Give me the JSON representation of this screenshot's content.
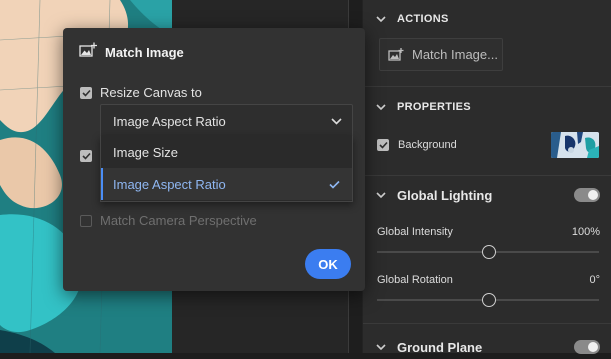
{
  "dialog": {
    "title": "Match Image",
    "resize_label": "Resize Canvas to",
    "dropdown_value": "Image Aspect Ratio",
    "options": [
      "Image Size",
      "Image Aspect Ratio"
    ],
    "selected_option": "Image Aspect Ratio",
    "match_camera_label": "Match Camera Perspective",
    "ok_label": "OK"
  },
  "panel": {
    "actions_title": "ACTIONS",
    "action_item": "Match Image...",
    "properties_title": "PROPERTIES",
    "background_label": "Background",
    "global_lighting_title": "Global Lighting",
    "global_intensity_label": "Global Intensity",
    "global_intensity_value": "100%",
    "global_rotation_label": "Global Rotation",
    "global_rotation_value": "0°",
    "ground_plane_title": "Ground Plane"
  },
  "colors": {
    "accent": "#3b7df0",
    "selected_text": "#8fb7f2",
    "panel_bg": "#2c2c2c",
    "dialog_bg": "#323232"
  },
  "icons": [
    "image-match-icon",
    "chevron-down-icon",
    "checkmark-icon",
    "toggle-switch"
  ]
}
